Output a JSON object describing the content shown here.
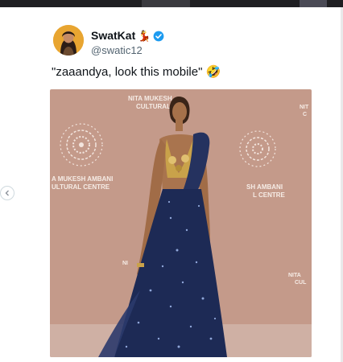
{
  "tweet": {
    "display_name": "SwatKat",
    "name_emoji": "💃",
    "handle": "@swatic12",
    "text": "\"zaaandya, look this mobile\"",
    "text_emoji": "🤣"
  },
  "media": {
    "backdrop_lines": {
      "center_top_1": "NITA MUKESH",
      "center_top_2": "CULTURAL",
      "left_1": "A MUKESH AMBANI",
      "left_2": "ULTURAL CENTRE",
      "right_1": "SH AMBANI",
      "right_2": "L CENTRE",
      "right_top_1": "NIT",
      "right_top_2": "C",
      "right_bottom_1": "NITA",
      "right_bottom_2": "CUL",
      "mid_left": "NI"
    }
  },
  "colors": {
    "backdrop": "#c49a8a",
    "floor": "#cfb0a4",
    "dress": "#1d2a55",
    "gold": "#c9a24a",
    "verified": "#1d9bf0"
  }
}
